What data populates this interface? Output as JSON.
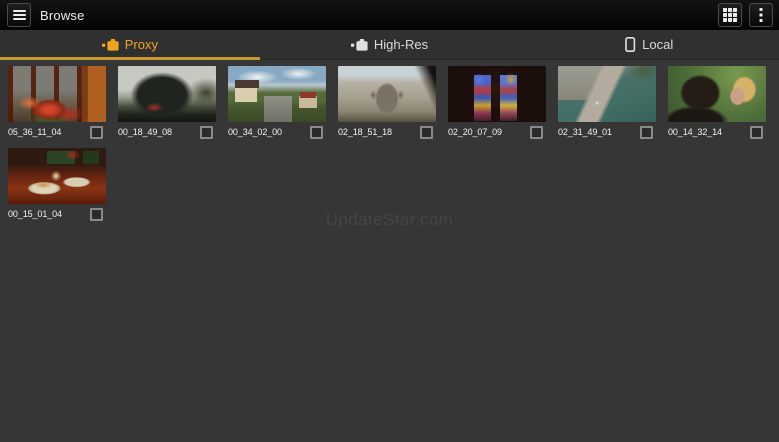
{
  "header": {
    "title": "Browse",
    "menu_icon": "hamburger-icon",
    "grid_view_icon": "grid-view-icon",
    "overflow_icon": "overflow-menu-icon"
  },
  "tabs": [
    {
      "label": "Proxy",
      "icon": "proxy-clip-icon",
      "active": true
    },
    {
      "label": "High-Res",
      "icon": "highres-clip-icon",
      "active": false
    },
    {
      "label": "Local",
      "icon": "phone-icon",
      "active": false
    }
  ],
  "grid": {
    "items": [
      {
        "label": "05_36_11_04",
        "scene": "window frame with red flowers"
      },
      {
        "label": "00_18_49_08",
        "scene": "steam locomotive under cloudy sky"
      },
      {
        "label": "00_34_02_00",
        "scene": "railway station in green valley"
      },
      {
        "label": "02_18_51_18",
        "scene": "stone church facade from below"
      },
      {
        "label": "02_20_07_09",
        "scene": "stained glass windows in dark interior"
      },
      {
        "label": "02_31_49_01",
        "scene": "aerial view of bridge over teal river"
      },
      {
        "label": "00_14_32_14",
        "scene": "man and blonde woman against greenery"
      },
      {
        "label": "00_15_01_04",
        "scene": "candle-lit dinner table with plates"
      }
    ]
  },
  "watermark": "UpdateStar.com",
  "colors": {
    "accent": "#efa51c",
    "tab_underline": "#c9992b",
    "top_bar": "#070707",
    "tab_bar": "#303030",
    "content_bg": "#363636"
  }
}
